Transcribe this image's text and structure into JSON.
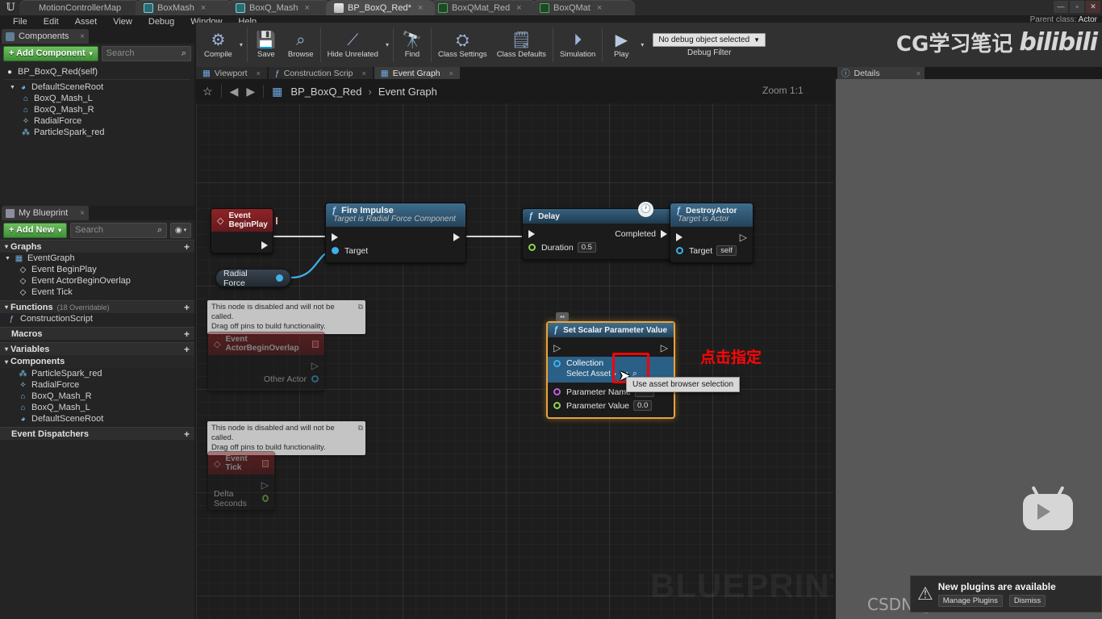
{
  "window": {
    "app_icon": "unreal-logo",
    "tabs": [
      {
        "label": "MotionControllerMap",
        "icon": "level-icon",
        "closeable": false,
        "active": false
      },
      {
        "label": "BoxMash",
        "icon": "mesh-icon",
        "closeable": true,
        "active": false
      },
      {
        "label": "BoxQ_Mash",
        "icon": "mesh-icon",
        "closeable": true,
        "active": false
      },
      {
        "label": "BP_BoxQ_Red*",
        "icon": "blueprint-icon",
        "closeable": true,
        "active": true
      },
      {
        "label": "BoxQMat_Red",
        "icon": "material-icon",
        "closeable": true,
        "active": false
      },
      {
        "label": "BoxQMat",
        "icon": "material-icon",
        "closeable": true,
        "active": false
      }
    ],
    "controls": [
      "minimize",
      "maximize",
      "close"
    ]
  },
  "menu": {
    "items": [
      "File",
      "Edit",
      "Asset",
      "View",
      "Debug",
      "Window",
      "Help"
    ],
    "parent_class_label": "Parent class:",
    "parent_class_value": "Actor"
  },
  "toolbar": {
    "buttons": [
      {
        "label": "Compile",
        "icon": "compile-icon",
        "has_caret": true
      },
      {
        "label": "Save",
        "icon": "save-icon",
        "has_caret": false
      },
      {
        "label": "Browse",
        "icon": "browse-icon",
        "has_caret": false
      },
      {
        "label": "Hide Unrelated",
        "icon": "hide-unrelated-icon",
        "has_caret": true
      },
      {
        "label": "Find",
        "icon": "find-icon",
        "has_caret": false
      },
      {
        "label": "Class Settings",
        "icon": "class-settings-icon",
        "has_caret": false
      },
      {
        "label": "Class Defaults",
        "icon": "class-defaults-icon",
        "has_caret": false
      },
      {
        "label": "Simulation",
        "icon": "simulation-icon",
        "has_caret": false
      },
      {
        "label": "Play",
        "icon": "play-icon",
        "has_caret": true
      }
    ],
    "debug_filter": {
      "selected": "No debug object selected",
      "caption": "Debug Filter"
    }
  },
  "watermarks": {
    "cg_text": "CG学习笔记",
    "bili_text": "bilibili",
    "blueprint_text": "BLUEPRINT",
    "csdn_text": "CSDN @这个软件需要设计一下",
    "tv_icon": "bilibili-tv-icon"
  },
  "components_panel": {
    "tab_label": "Components",
    "tab_icon": "components-icon",
    "add_component_label": "+ Add Component",
    "add_component_caret": "▾",
    "search_placeholder": "Search",
    "search_icon": "search-icon",
    "tree": [
      {
        "label": "BP_BoxQ_Red(self)",
        "icon": "blueprint-self-icon",
        "indent": 0
      },
      {
        "label": "DefaultSceneRoot",
        "icon": "scene-root-icon",
        "indent": 1,
        "expander": "▾"
      },
      {
        "label": "BoxQ_Mash_L",
        "icon": "static-mesh-icon",
        "indent": 2
      },
      {
        "label": "BoxQ_Mash_R",
        "icon": "static-mesh-icon",
        "indent": 2
      },
      {
        "label": "RadialForce",
        "icon": "radial-force-icon",
        "indent": 2
      },
      {
        "label": "ParticleSpark_red",
        "icon": "particle-icon",
        "indent": 2
      }
    ]
  },
  "myblueprint_panel": {
    "tab_label": "My Blueprint",
    "tab_icon": "blueprint-panel-icon",
    "add_new_label": "+ Add New",
    "add_new_caret": "▾",
    "search_placeholder": "Search",
    "eye_icon": "eye-icon",
    "sections": [
      {
        "title": "Graphs",
        "sub": "",
        "plus": "+",
        "arrow": "▾",
        "items": [
          {
            "label": "EventGraph",
            "icon": "graph-icon",
            "indent": 1,
            "arrow": "▾"
          },
          {
            "label": "Event BeginPlay",
            "icon": "event-node-icon",
            "indent": 2
          },
          {
            "label": "Event ActorBeginOverlap",
            "icon": "event-node-icon",
            "indent": 2
          },
          {
            "label": "Event Tick",
            "icon": "event-node-icon",
            "indent": 2
          }
        ]
      },
      {
        "title": "Functions",
        "sub": "(18 Overridable)",
        "plus": "+",
        "arrow": "▾",
        "items": [
          {
            "label": "ConstructionScript",
            "icon": "function-icon",
            "indent": 1
          }
        ]
      },
      {
        "title": "Macros",
        "sub": "",
        "plus": "+",
        "arrow": "",
        "items": []
      },
      {
        "title": "Variables",
        "sub": "",
        "plus": "+",
        "arrow": "▾",
        "items": []
      },
      {
        "title": "Components",
        "sub": "",
        "plus": "",
        "arrow": "▾",
        "items": [
          {
            "label": "ParticleSpark_red",
            "icon": "particle-icon",
            "indent": 2
          },
          {
            "label": "RadialForce",
            "icon": "radial-force-icon",
            "indent": 2
          },
          {
            "label": "BoxQ_Mash_R",
            "icon": "static-mesh-icon",
            "indent": 2
          },
          {
            "label": "BoxQ_Mash_L",
            "icon": "static-mesh-icon",
            "indent": 2
          },
          {
            "label": "DefaultSceneRoot",
            "icon": "scene-root-icon",
            "indent": 2
          }
        ]
      },
      {
        "title": "Event Dispatchers",
        "sub": "",
        "plus": "+",
        "arrow": "",
        "items": []
      }
    ]
  },
  "graph": {
    "doc_tabs": [
      {
        "label": "Viewport",
        "icon": "viewport-icon",
        "active": false,
        "close": "×"
      },
      {
        "label": "Construction Scrip",
        "icon": "function-icon",
        "active": false,
        "close": "×"
      },
      {
        "label": "Event Graph",
        "icon": "graph-icon",
        "active": true,
        "close": "×"
      }
    ],
    "favorite_icon": "star-icon",
    "back_icon": "back-arrow-icon",
    "forward_icon": "forward-arrow-icon",
    "breadcrumb_icon": "graph-icon",
    "breadcrumb_root": "BP_BoxQ_Red",
    "breadcrumb_sep": "›",
    "breadcrumb_leaf": "Event Graph",
    "zoom_label": "Zoom 1:1",
    "nodes": {
      "event_beginplay": {
        "title": "Event BeginPlay",
        "icon": "event-diamond-icon",
        "badge": "delegate-icon"
      },
      "fire_impulse": {
        "title": "Fire Impulse",
        "subtitle": "Target is Radial Force Component",
        "icon": "function-f-icon",
        "pins": [
          {
            "label": "Target",
            "type": "object"
          }
        ]
      },
      "radial_force_getter": {
        "label": "Radial Force"
      },
      "delay": {
        "title": "Delay",
        "icon": "function-f-icon",
        "clock_icon": "clock-icon",
        "out_label": "Completed",
        "duration_label": "Duration",
        "duration_value": "0.5"
      },
      "destroy_actor": {
        "title": "DestroyActor",
        "subtitle": "Target is Actor",
        "icon": "function-f-icon",
        "target_label": "Target",
        "target_value": "self"
      },
      "event_actorbeginoverlap": {
        "title": "Event ActorBeginOverlap",
        "icon": "event-diamond-icon",
        "pin_label": "Other Actor",
        "disabled_note": "This node is disabled and will not be called.\nDrag off pins to build functionality."
      },
      "event_tick": {
        "title": "Event Tick",
        "icon": "event-diamond-icon",
        "pin_label": "Delta Seconds",
        "disabled_note": "This node is disabled and will not be called.\nDrag off pins to build functionality."
      },
      "set_scalar_parameter_value": {
        "title": "Set Scalar Parameter Value",
        "icon": "function-f-icon",
        "collection_label": "Collection",
        "collection_value": "Select Asset",
        "collection_caret": "▾",
        "use_browser_icon": "use-asset-browser-icon",
        "browse_icon": "browse-asset-icon",
        "param_name_label": "Parameter Name",
        "param_value_label": "Parameter Value",
        "param_value": "0.0",
        "selected": true
      }
    },
    "annotations": {
      "red_text": "点击指定",
      "tooltip": "Use asset browser selection"
    }
  },
  "details_panel": {
    "tab_label": "Details",
    "tab_icon": "details-icon",
    "close": "×"
  },
  "notification": {
    "title": "New plugins are available",
    "warn_icon": "warning-icon",
    "buttons": [
      "Manage Plugins",
      "Dismiss"
    ]
  },
  "colors": {
    "accent_orange": "#e8a33d",
    "exec_white": "#e8e8e8",
    "object_blue": "#3fb0e8",
    "float_green": "#8fd44a",
    "name_purple": "#c060d8",
    "event_red": "#8f2326",
    "annotation_red": "#ff0606",
    "green_button": "#4f9f43"
  }
}
